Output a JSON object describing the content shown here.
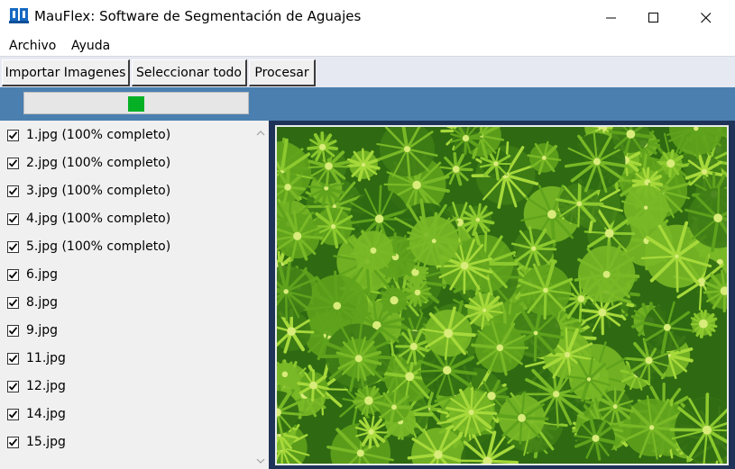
{
  "window": {
    "title": "MauFlex: Software de Segmentación de Aguajes",
    "app_icon": "mauflex-logo-icon",
    "controls": [
      "minimize-icon",
      "maximize-icon",
      "close-icon"
    ]
  },
  "menu": {
    "items": [
      {
        "label": "Archivo"
      },
      {
        "label": "Ayuda"
      }
    ]
  },
  "toolbar": {
    "import_label": "Importar Imagenes",
    "select_all_label": "Seleccionar todo",
    "process_label": "Procesar"
  },
  "progress": {
    "indicator": "marquee",
    "chunk_color": "#06b025"
  },
  "file_list": {
    "items": [
      {
        "label": "1.jpg (100% completo)",
        "checked": true
      },
      {
        "label": "2.jpg (100% completo)",
        "checked": true
      },
      {
        "label": "3.jpg (100% completo)",
        "checked": true
      },
      {
        "label": "4.jpg (100% completo)",
        "checked": true
      },
      {
        "label": "5.jpg (100% completo)",
        "checked": true
      },
      {
        "label": "6.jpg",
        "checked": true
      },
      {
        "label": "8.jpg",
        "checked": true
      },
      {
        "label": "9.jpg",
        "checked": true
      },
      {
        "label": "11.jpg",
        "checked": true
      },
      {
        "label": "12.jpg",
        "checked": true
      },
      {
        "label": "14.jpg",
        "checked": true
      },
      {
        "label": "15.jpg",
        "checked": true
      }
    ]
  },
  "preview": {
    "content": "aerial-palm-canopy-photo",
    "colors": {
      "background": "#1f3358",
      "foliage_dark": "#2f6a12",
      "foliage_mid": "#5fa21c",
      "foliage_light": "#a6d93a"
    }
  },
  "theme": {
    "toolbar_bg": "#e7e9f2",
    "strip_bg": "#4a7fb0",
    "list_bg": "#f0f0f0"
  }
}
